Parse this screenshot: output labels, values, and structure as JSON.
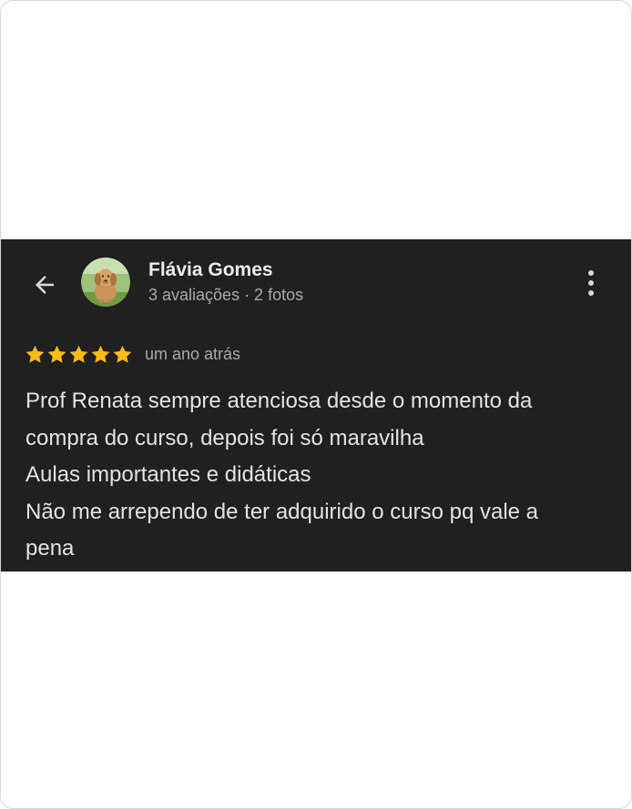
{
  "reviewer": {
    "name": "Flávia Gomes",
    "stats": "3 avaliações · 2 fotos",
    "avatar_icon": "dog-avatar"
  },
  "review": {
    "stars": 5,
    "max_stars": 5,
    "star_color": "#F9BC15",
    "time": "um ano atrás",
    "lines": [
      "Prof Renata sempre atenciosa desde o momento da",
      "compra do curso, depois foi só maravilha",
      "Aulas importantes e didáticas",
      "Não me arrependo de ter adquirido o curso pq vale a",
      "pena"
    ]
  },
  "icons": {
    "back": "arrow-left-icon",
    "more": "more-vertical-icon"
  },
  "colors": {
    "card_background": "#202020",
    "page_background": "#FFFFFF"
  }
}
